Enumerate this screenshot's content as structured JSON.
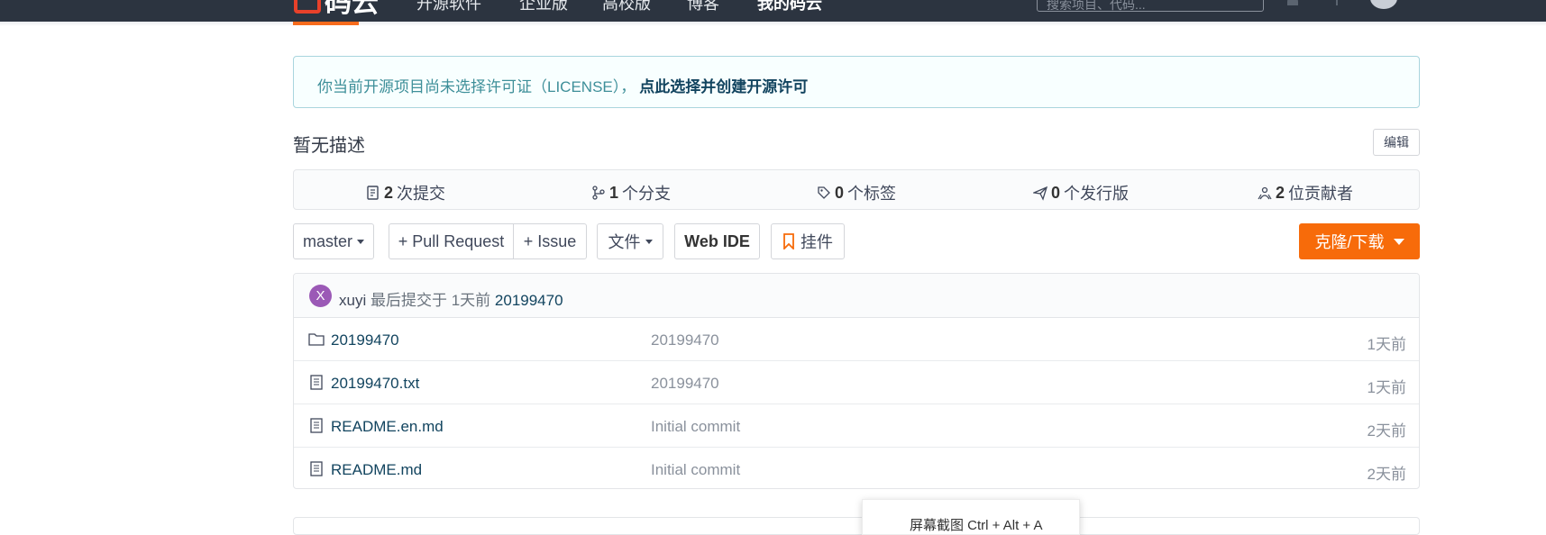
{
  "navbar": {
    "logo_text": "码云",
    "items": [
      "开源软件",
      "企业版",
      "高校版",
      "博客"
    ],
    "my_item": "我的码云",
    "search_placeholder": "搜索项目、代码..."
  },
  "notice": {
    "text": "你当前开源项目尚未选择许可证（LICENSE），",
    "link": "点此选择并创建开源许可"
  },
  "repo": {
    "description": "暂无描述",
    "edit_label": "编辑"
  },
  "stats": [
    {
      "icon": "commit-icon",
      "count": "2",
      "label": "次提交"
    },
    {
      "icon": "branch-icon",
      "count": "1",
      "label": "个分支"
    },
    {
      "icon": "tag-icon",
      "count": "0",
      "label": "个标签"
    },
    {
      "icon": "release-icon",
      "count": "0",
      "label": "个发行版"
    },
    {
      "icon": "contributors-icon",
      "count": "2",
      "label": "位贡献者"
    }
  ],
  "toolbar": {
    "branch": "master",
    "pull_request": "+ Pull Request",
    "issue": "+ Issue",
    "file": "文件",
    "web_ide": "Web IDE",
    "widget": "挂件",
    "clone": "克隆/下载"
  },
  "last_commit": {
    "avatar_letter": "X",
    "author": "xuyi",
    "text": "最后提交于",
    "time": "1天前",
    "hash": "20199470"
  },
  "files": [
    {
      "type": "folder-icon",
      "name": "20199470",
      "message": "20199470",
      "time": "1天前"
    },
    {
      "type": "file-icon",
      "name": "20199470.txt",
      "message": "20199470",
      "time": "1天前"
    },
    {
      "type": "file-icon",
      "name": "README.en.md",
      "message": "Initial commit",
      "time": "2天前"
    },
    {
      "type": "file-icon",
      "name": "README.md",
      "message": "Initial commit",
      "time": "2天前"
    }
  ],
  "tooltip": {
    "text": "屏幕截图 Ctrl + Alt + A"
  },
  "colors": {
    "accent": "#f76b0a",
    "navbar": "#2c3440",
    "link": "#12445f",
    "notice_text": "#3e8f99"
  }
}
